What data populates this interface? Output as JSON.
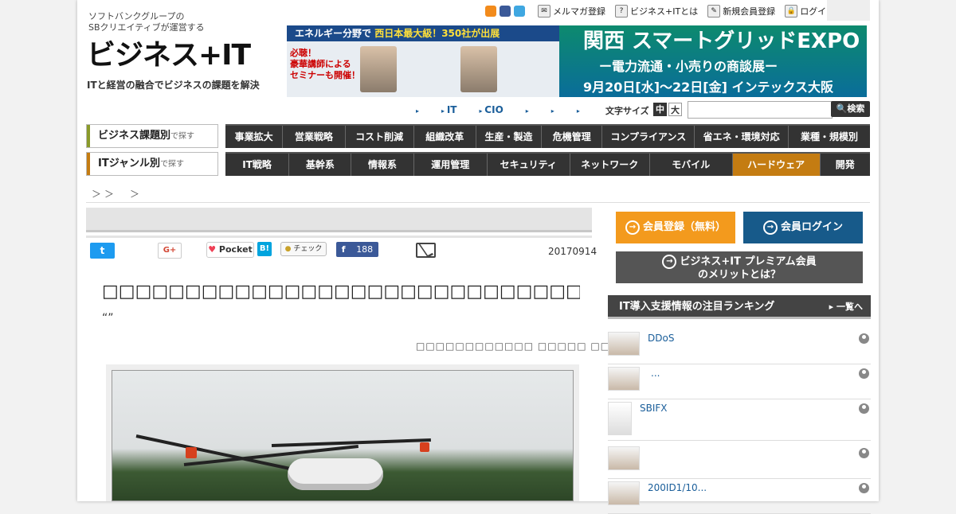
{
  "logo": {
    "tagline": "ソフトバンクグループの\nSBクリエイティブが運営する",
    "name": "ビジネス+IT",
    "subtitle": "ITと経営の融合でビジネスの課題を解決"
  },
  "header_links": {
    "mailmag": "メルマガ登録",
    "about": "ビジネス+ITとは",
    "register": "新規会員登録",
    "login": "ログイン"
  },
  "banner": {
    "top": "エネルギー分野で",
    "top_highlight": "西日本最大級！350社が出展",
    "left_text": "必聴！\n豪華講師による\nセミナーも開催！",
    "title": "関西 スマートグリッドEXPO",
    "subtitle": "ー電力流通・小売りの商談展ー",
    "date": "9月20日[水]〜22日[金] インテックス大阪"
  },
  "mini_nav": [
    "",
    "IT",
    "CIO",
    "",
    "",
    ""
  ],
  "font_size": {
    "label": "文字サイズ",
    "medium": "中",
    "large": "大"
  },
  "search": {
    "placeholder": "",
    "button": "検索"
  },
  "category_business": {
    "label": "ビジネス課題別",
    "suffix": "で探す",
    "items": [
      "事業拡大",
      "営業戦略",
      "コスト削減",
      "組織改革",
      "生産・製造",
      "危機管理",
      "コンプライアンス",
      "省エネ・環境対応",
      "業種・規模別"
    ]
  },
  "category_it": {
    "label": "ITジャンル別",
    "suffix": "で探す",
    "items": [
      "IT戦略",
      "基幹系",
      "情報系",
      "運用管理",
      "セキュリティ",
      "ネットワーク",
      "モバイル",
      "ハードウェア",
      "開発"
    ]
  },
  "breadcrumb": "＞＞　＞",
  "share": {
    "twitter": "🐦",
    "gplus": "G+",
    "pocket": "Pocket",
    "hatena": "B!",
    "check": "チェック",
    "facebook_count": "188"
  },
  "article": {
    "date": "20170914",
    "title": "□□□□□□□□□□□□□□□□□□□□□□□□□□□□□□□□□",
    "subtitle": "“”",
    "author": "□□□□□□□□□□□□ □□□□□ □□ □□"
  },
  "sidebar": {
    "register_button": "会員登録（無料）",
    "login_button": "会員ログイン",
    "premium_line1": "ビジネス+IT プレミアム会員",
    "premium_line2": "のメリットとは？",
    "ranking_title": "IT導入支援情報の注目ランキング",
    "ranking_more": "一覧へ",
    "ranking": [
      "DDoS",
      "...",
      "SBIFX",
      "",
      "200ID1/10..."
    ]
  },
  "colors": {
    "accent_orange": "#f39a1d",
    "accent_blue": "#175a8a",
    "nav_dark": "#333333",
    "active_tab": "#c47c12"
  }
}
